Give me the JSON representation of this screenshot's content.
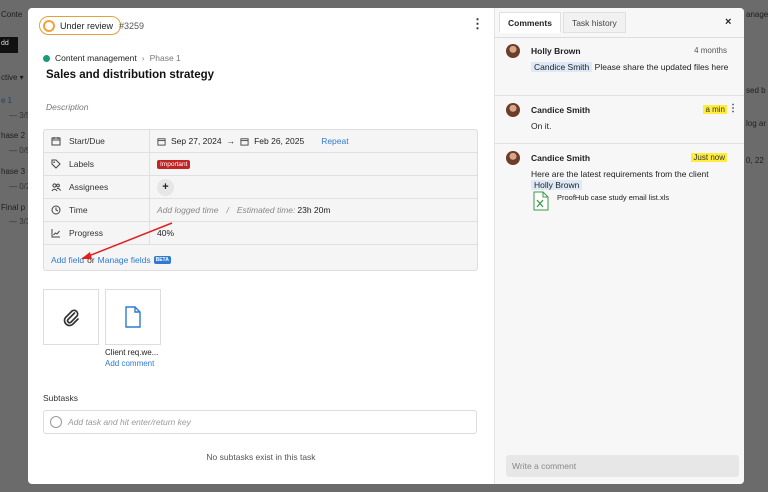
{
  "background": {
    "items": [
      "Conte",
      "dd",
      "ctive ▾",
      "e 1",
      "— 3/5",
      "hase 2",
      "— 0/9",
      "hase 3",
      "— 0/2",
      "Final p",
      "— 3/3",
      "anage",
      "sed b",
      "log ar",
      "0, 22"
    ]
  },
  "task": {
    "status": "Under review",
    "id": "#3259",
    "project": "Content management",
    "phase": "Phase 1",
    "title": "Sales and distribution strategy",
    "description_placeholder": "Description"
  },
  "fields": {
    "start_due": {
      "label": "Start/Due",
      "start": "Sep 27, 2024",
      "arrow": "→",
      "due": "Feb 26, 2025",
      "repeat": "Repeat"
    },
    "labels": {
      "label": "Labels",
      "tag": "Important"
    },
    "assignees": {
      "label": "Assignees",
      "add": "+"
    },
    "time": {
      "label": "Time",
      "logged": "Add logged time",
      "sep": "/",
      "estimated_label": "Estimated time:",
      "estimated_value": "23h 20m"
    },
    "progress": {
      "label": "Progress",
      "value": "40%"
    },
    "add_field": "Add field",
    "or": "or",
    "manage_fields": "Manage fields",
    "beta": "BETA"
  },
  "attachments": [
    {
      "icon": "paperclip-icon"
    },
    {
      "icon": "document-icon",
      "name": "Client req.we...",
      "action": "Add comment"
    }
  ],
  "subtasks": {
    "heading": "Subtasks",
    "placeholder": "Add task and hit enter/return key",
    "empty": "No subtasks exist in this task"
  },
  "panel": {
    "tabs": [
      "Comments",
      "Task history"
    ],
    "active_tab": "Comments",
    "close": "×",
    "comment_placeholder": "Write a comment"
  },
  "comments": [
    {
      "author": "Holly Brown",
      "time": "4 months",
      "mention": "Candice Smith",
      "text": "Please share the updated files here"
    },
    {
      "author": "Candice Smith",
      "time": "a min",
      "text": "On it."
    },
    {
      "author": "Candice Smith",
      "time": "Just now",
      "text": "Here are the latest requirements from the client",
      "mention": "Holly Brown",
      "file": "ProofHub case study email list.xls"
    }
  ],
  "colors": {
    "accent": "#2f7bd3",
    "status_ring": "#f2a23a",
    "important": "#c22424",
    "project_dot": "#1a9a7a",
    "highlight": "#ffec3d",
    "annotation_arrow": "#e02020"
  }
}
